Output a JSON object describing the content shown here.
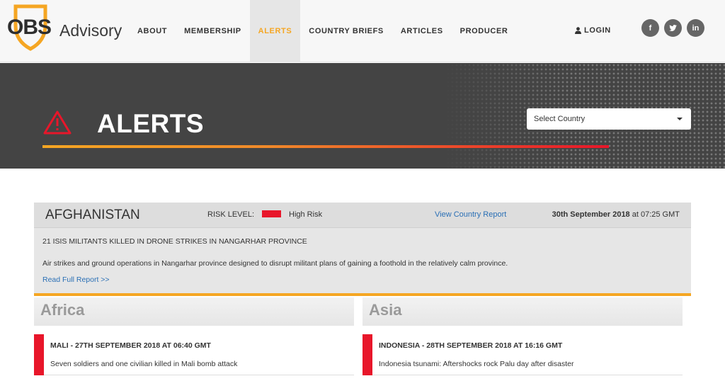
{
  "brand": {
    "logo_text": "OBS",
    "name": "Advisory"
  },
  "nav": {
    "items": [
      {
        "label": "ABOUT"
      },
      {
        "label": "MEMBERSHIP"
      },
      {
        "label": "ALERTS"
      },
      {
        "label": "COUNTRY BRIEFS"
      },
      {
        "label": "ARTICLES"
      },
      {
        "label": "PRODUCER"
      }
    ],
    "active": "ALERTS",
    "login_label": "LOGIN",
    "social": [
      {
        "label": "f"
      },
      {
        "label": "t"
      },
      {
        "label": "in"
      }
    ]
  },
  "banner": {
    "title": "ALERTS",
    "select_country": "Select Country"
  },
  "featured_alert": {
    "country": "AFGHANISTAN",
    "risk_label": "RISK LEVEL:",
    "risk_level": "High Risk",
    "view_report": "View Country Report",
    "date_bold": "30th September 2018",
    "date_rest": " at 07:25 GMT",
    "headline": "21 ISIS MILITANTS KILLED IN DRONE STRIKES IN NANGARHAR PROVINCE",
    "summary": "Air strikes and ground operations in Nangarhar province designed to disrupt militant plans of gaining a foothold in the relatively calm province.",
    "read_more": "Read Full Report >>"
  },
  "regions": [
    {
      "name": "Africa",
      "alerts": [
        {
          "title": "MALI - 27TH SEPTEMBER 2018 AT 06:40 GMT",
          "text": "Seven soldiers and one civilian killed in Mali bomb attack"
        }
      ]
    },
    {
      "name": "Asia",
      "alerts": [
        {
          "title": "INDONESIA - 28TH SEPTEMBER 2018 AT 16:16 GMT",
          "text": "Indonesia tsunami: Aftershocks rock Palu day after disaster"
        }
      ]
    }
  ],
  "colors": {
    "accent": "#f5a623",
    "risk_high": "#e8162a",
    "link": "#2a6fb5"
  }
}
